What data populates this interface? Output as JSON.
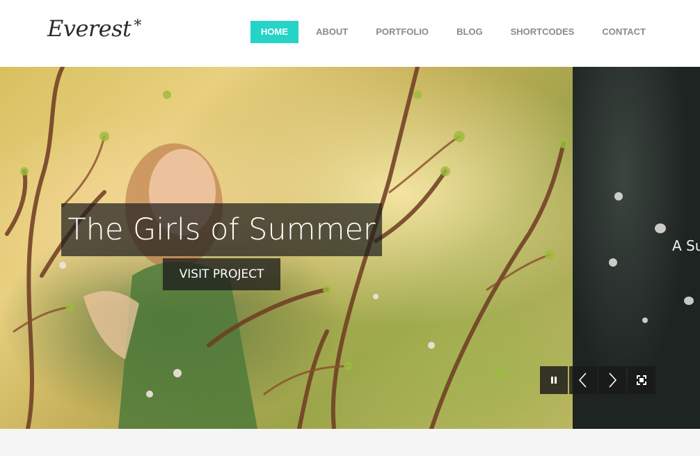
{
  "brand": {
    "name": "Everest",
    "mark": "*"
  },
  "nav": {
    "items": [
      {
        "label": "HOME",
        "active": true
      },
      {
        "label": "ABOUT",
        "active": false
      },
      {
        "label": "PORTFOLIO",
        "active": false
      },
      {
        "label": "BLOG",
        "active": false
      },
      {
        "label": "SHORTCODES",
        "active": false
      },
      {
        "label": "CONTACT",
        "active": false
      }
    ]
  },
  "slider": {
    "current": {
      "title": "The Girls of Summer",
      "button_label": "VISIT PROJECT"
    },
    "next": {
      "title_partial": "A Su"
    },
    "controls": [
      {
        "icon": "pause-icon"
      },
      {
        "icon": "arrow-left-icon"
      },
      {
        "icon": "arrow-right-icon"
      },
      {
        "icon": "fullscreen-icon"
      }
    ]
  },
  "colors": {
    "accent": "#26d4c7",
    "nav_text": "#8a8a8a",
    "overlay": "#1e1e1e"
  }
}
